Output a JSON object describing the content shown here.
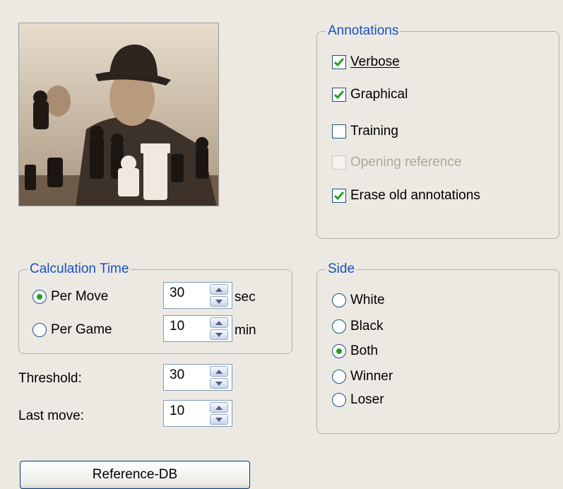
{
  "annotations": {
    "title": "Annotations",
    "verbose": {
      "label": "Verbose",
      "checked": true
    },
    "graphical": {
      "label": "Graphical",
      "checked": true
    },
    "training": {
      "label": "Training",
      "checked": false
    },
    "opening_reference": {
      "label": "Opening reference",
      "checked": false,
      "disabled": true
    },
    "erase_old": {
      "label": "Erase old annotations",
      "checked": true
    }
  },
  "calculation_time": {
    "title": "Calculation Time",
    "per_move": {
      "label": "Per Move",
      "value": "30",
      "unit": "sec",
      "selected": true
    },
    "per_game": {
      "label": "Per Game",
      "value": "10",
      "unit": "min",
      "selected": false
    }
  },
  "threshold": {
    "label": "Threshold:",
    "value": "30"
  },
  "last_move": {
    "label": "Last move:",
    "value": "10"
  },
  "side": {
    "title": "Side",
    "options": [
      {
        "label": "White",
        "selected": false
      },
      {
        "label": "Black",
        "selected": false
      },
      {
        "label": "Both",
        "selected": true
      },
      {
        "label": "Winner",
        "selected": false
      },
      {
        "label": "Loser",
        "selected": false
      }
    ]
  },
  "reference_db_button": "Reference-DB",
  "colors": {
    "legend": "#1c4ec0",
    "check": "#21a121",
    "background": "#ebe9e2"
  }
}
